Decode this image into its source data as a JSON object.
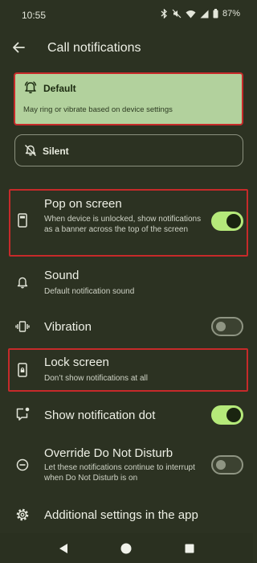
{
  "status_bar": {
    "time": "10:55",
    "battery": "87%",
    "icons": [
      "bluetooth-icon",
      "mute-icon",
      "wifi-icon",
      "signal-icon",
      "battery-icon"
    ]
  },
  "header": {
    "title": "Call notifications",
    "back_icon": "arrow-left-icon"
  },
  "priority": {
    "default": {
      "label": "Default",
      "description": "May ring or vibrate based on device settings",
      "icon": "bell-icon",
      "selected": true
    },
    "silent": {
      "label": "Silent",
      "icon": "bell-off-icon",
      "selected": false
    }
  },
  "settings": {
    "pop_on_screen": {
      "title": "Pop on screen",
      "description": "When device is unlocked, show notifications as a banner across the top of the screen",
      "enabled": true
    },
    "sound": {
      "title": "Sound",
      "description": "Default notification sound"
    },
    "vibration": {
      "title": "Vibration",
      "enabled": false
    },
    "lock_screen": {
      "title": "Lock screen",
      "description": "Don’t show notifications at all"
    },
    "notification_dot": {
      "title": "Show notification dot",
      "enabled": true
    },
    "override_dnd": {
      "title": "Override Do Not Disturb",
      "description": "Let these notifications continue to interrupt when Do Not Disturb is on",
      "enabled": false
    },
    "additional": {
      "title": "Additional settings in the app"
    }
  },
  "colors": {
    "background": "#2c3222",
    "accent_toggle": "#b5e97a",
    "selected_card": "#b2d19d",
    "highlight_outline": "#c62a2a"
  },
  "nav": {
    "buttons": [
      "back-triangle-icon",
      "home-circle-icon",
      "recents-square-icon"
    ]
  }
}
